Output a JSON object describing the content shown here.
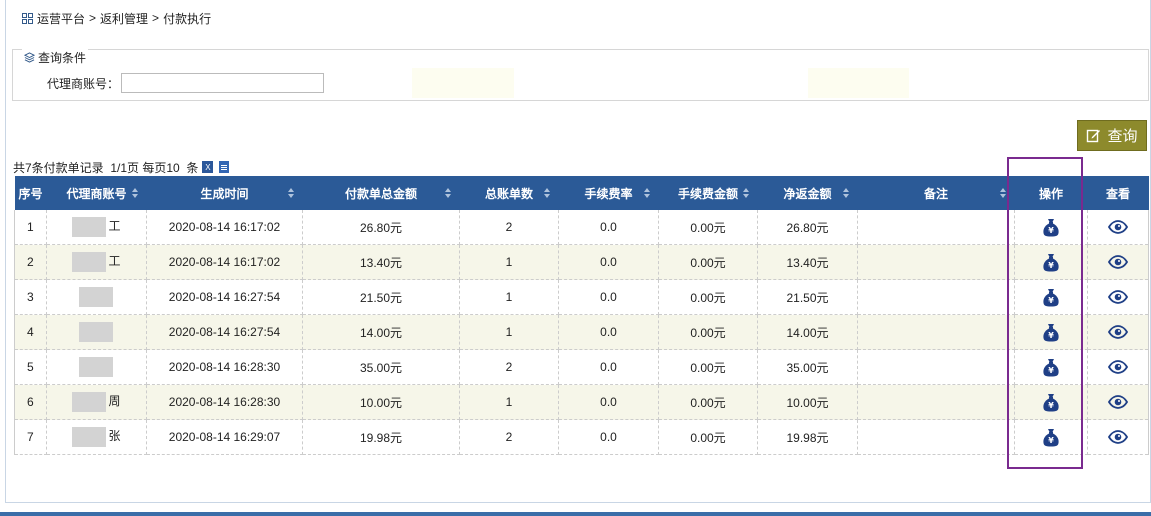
{
  "breadcrumb": [
    "运营平台",
    ">",
    "返利管理",
    ">",
    "付款执行"
  ],
  "query": {
    "legend": "查询条件",
    "agent_label": "代理商账号：",
    "agent_value": "",
    "button_label": "查询"
  },
  "summary": {
    "text": "共7条付款单记录  1/1页 每页10  条"
  },
  "table": {
    "headers": [
      "序号",
      "代理商账号",
      "生成时间",
      "付款单总金额",
      "总账单数",
      "手续费率",
      "手续费金额",
      "净返金额",
      "备注",
      "操作",
      "查看"
    ],
    "rows": [
      {
        "no": "1",
        "agent": "工",
        "time": "2020-08-14 16:17:02",
        "total": "26.80元",
        "count": "2",
        "rate": "0.0",
        "fee": "0.00元",
        "net": "26.80元",
        "remark": ""
      },
      {
        "no": "2",
        "agent": "工",
        "time": "2020-08-14 16:17:02",
        "total": "13.40元",
        "count": "1",
        "rate": "0.0",
        "fee": "0.00元",
        "net": "13.40元",
        "remark": ""
      },
      {
        "no": "3",
        "agent": "",
        "time": "2020-08-14 16:27:54",
        "total": "21.50元",
        "count": "1",
        "rate": "0.0",
        "fee": "0.00元",
        "net": "21.50元",
        "remark": ""
      },
      {
        "no": "4",
        "agent": "",
        "time": "2020-08-14 16:27:54",
        "total": "14.00元",
        "count": "1",
        "rate": "0.0",
        "fee": "0.00元",
        "net": "14.00元",
        "remark": ""
      },
      {
        "no": "5",
        "agent": "",
        "time": "2020-08-14 16:28:30",
        "total": "35.00元",
        "count": "2",
        "rate": "0.0",
        "fee": "0.00元",
        "net": "35.00元",
        "remark": ""
      },
      {
        "no": "6",
        "agent": "周",
        "time": "2020-08-14 16:28:30",
        "total": "10.00元",
        "count": "1",
        "rate": "0.0",
        "fee": "0.00元",
        "net": "10.00元",
        "remark": ""
      },
      {
        "no": "7",
        "agent": "张",
        "time": "2020-08-14 16:29:07",
        "total": "19.98元",
        "count": "2",
        "rate": "0.0",
        "fee": "0.00元",
        "net": "19.98元",
        "remark": ""
      }
    ]
  },
  "colors": {
    "header_bg": "#2b5a97",
    "button_bg": "#8d8a2c",
    "icon_color": "#1f3f86",
    "highlight_border": "#7a2a8f"
  },
  "icons": {
    "breadcrumb": "grid-icon",
    "legend": "layers-icon",
    "query": "edit-icon",
    "pay": "money-bag-icon",
    "view": "eye-icon",
    "excel": "excel-icon",
    "doc": "document-icon"
  }
}
